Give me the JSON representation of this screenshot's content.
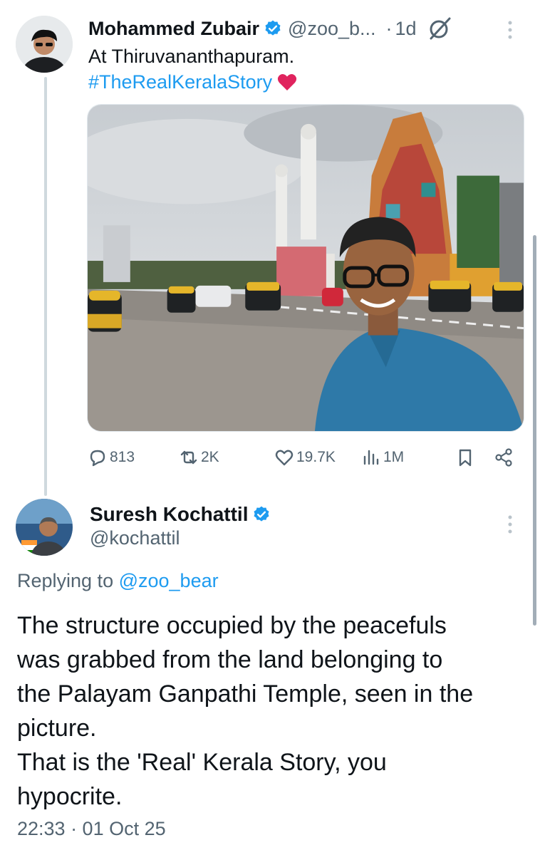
{
  "tweet": {
    "author": {
      "display_name": "Mohammed Zubair",
      "handle": "@zoo_b...",
      "verified": true
    },
    "time_ago": "1d",
    "text_line1": "At Thiruvananthapuram.",
    "hashtag": "#TheRealKeralaStory",
    "stats": {
      "replies": "813",
      "retweets": "2K",
      "likes": "19.7K",
      "views": "1M"
    }
  },
  "reply": {
    "author": {
      "display_name": "Suresh Kochattil",
      "handle": "@kochattil",
      "verified": true
    },
    "replying_to_prefix": "Replying to ",
    "replying_to_handle": "@zoo_bear",
    "body_lines": [
      "The structure occupied by the peacefuls",
      "was grabbed from the land belonging to",
      "the Palayam Ganpathi Temple, seen in the",
      "picture.",
      "That is the 'Real' Kerala Story, you",
      "hypocrite."
    ],
    "timestamp": "22:33 · 01 Oct 25"
  },
  "colors": {
    "accent": "#1d9bf0",
    "secondary_text": "#536471",
    "primary_text": "#0f1419",
    "heart": "#e0245e"
  },
  "icons": [
    "verified-badge-icon",
    "grok-icon",
    "more-icon",
    "heart-emoji-icon",
    "reply-icon",
    "retweet-icon",
    "like-icon",
    "views-icon",
    "bookmark-icon",
    "share-icon"
  ]
}
